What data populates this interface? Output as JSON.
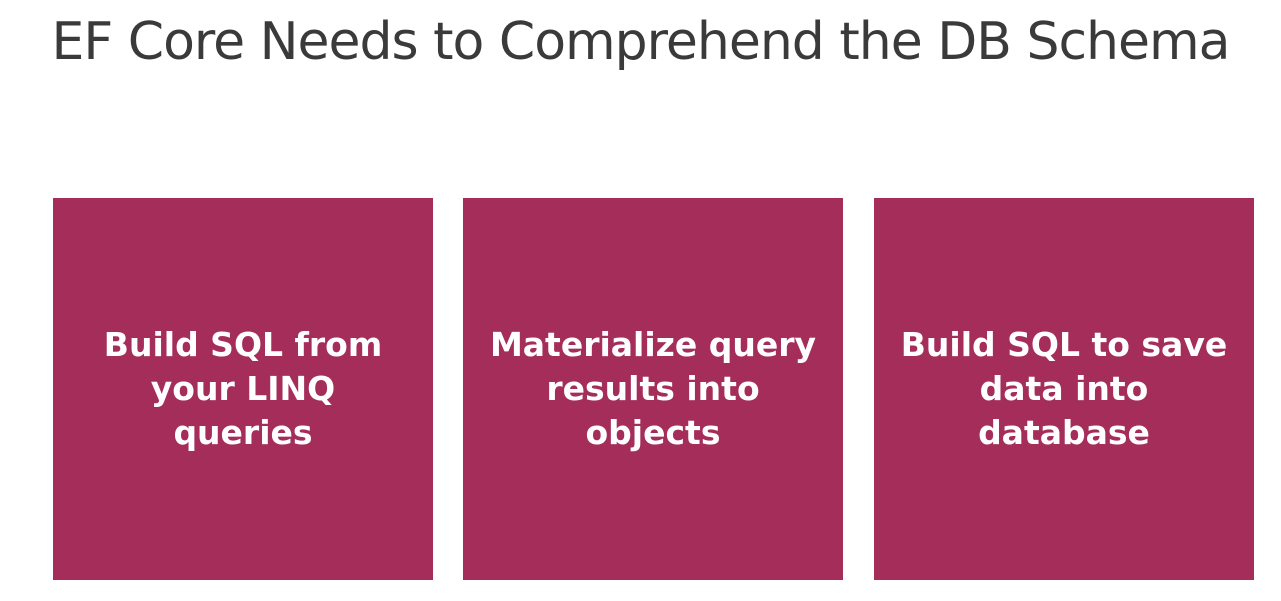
{
  "slide": {
    "title": "EF Core Needs to Comprehend the DB Schema"
  },
  "boxes": [
    {
      "text": "Build SQL from\nyour LINQ queries"
    },
    {
      "text": "Materialize query\nresults into\nobjects"
    },
    {
      "text": "Build SQL to save\ndata into\ndatabase"
    }
  ],
  "colors": {
    "box_fill": "#a52d5a",
    "box_text": "#ffffff",
    "title_text": "#3a3a3a"
  }
}
